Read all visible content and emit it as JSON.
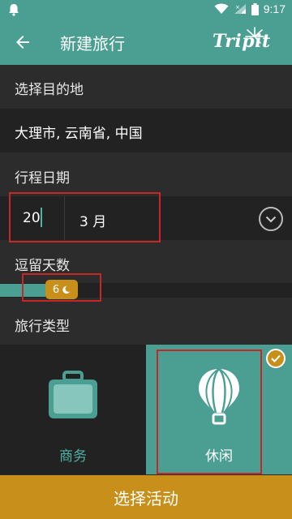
{
  "status_bar": {
    "time": "9:17"
  },
  "app_bar": {
    "title": "新建旅行",
    "brand": "Tripit"
  },
  "destination": {
    "label": "选择目的地",
    "value": "大理市, 云南省, 中国"
  },
  "dates": {
    "label": "行程日期",
    "year_value": "20",
    "month_value": "3 月"
  },
  "stay": {
    "label": "逗留天数",
    "days": "6",
    "fill_fraction": 0.16
  },
  "trip_type": {
    "label": "旅行类型",
    "options": [
      {
        "label": "商务",
        "selected": false
      },
      {
        "label": "休闲",
        "selected": true
      }
    ]
  },
  "action": {
    "label": "选择活动"
  },
  "colors": {
    "primary": "#4a9e92",
    "accent": "#c8901a",
    "background": "#2c2c2c",
    "highlight_box": "#c62828"
  }
}
